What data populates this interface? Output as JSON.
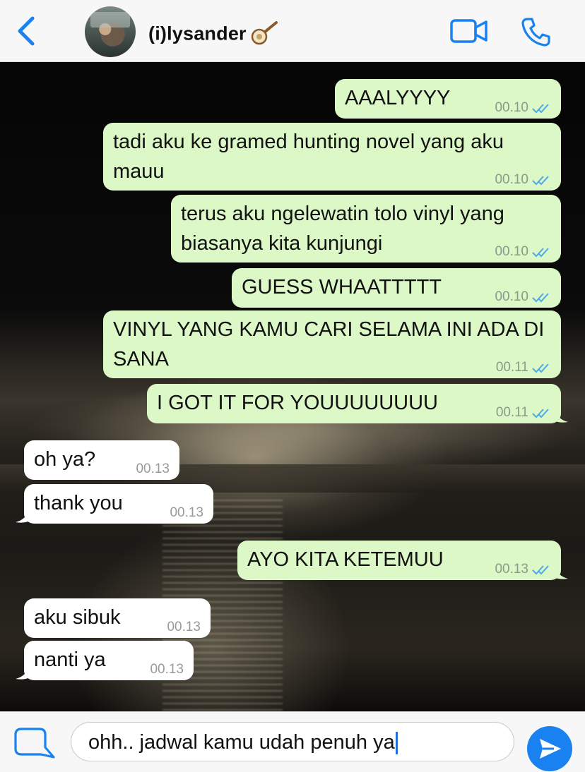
{
  "header": {
    "contact_name": "(i)lysander",
    "emoji": "🪕",
    "accent_color": "#1a82f0"
  },
  "messages": [
    {
      "direction": "out",
      "text": "AAALYYYY",
      "time": "00.10",
      "status": "read"
    },
    {
      "direction": "out",
      "text": "tadi aku ke gramed hunting novel yang aku mauu",
      "time": "00.10",
      "status": "read"
    },
    {
      "direction": "out",
      "text": "terus aku ngelewatin tolo vinyl yang biasanya kita kunjungi",
      "time": "00.10",
      "status": "read"
    },
    {
      "direction": "out",
      "text": "GUESS WHAATTTTT",
      "time": "00.10",
      "status": "read"
    },
    {
      "direction": "out",
      "text": "VINYL YANG KAMU CARI SELAMA INI ADA DI SANA",
      "time": "00.11",
      "status": "read"
    },
    {
      "direction": "out",
      "text": "I GOT IT FOR YOUUUUUUUU",
      "time": "00.11",
      "status": "read"
    },
    {
      "direction": "in",
      "text": "oh ya?",
      "time": "00.13"
    },
    {
      "direction": "in",
      "text": "thank you",
      "time": "00.13"
    },
    {
      "direction": "out",
      "text": "AYO KITA KETEMUU",
      "time": "00.13",
      "status": "read"
    },
    {
      "direction": "in",
      "text": "aku sibuk",
      "time": "00.13"
    },
    {
      "direction": "in",
      "text": "nanti ya",
      "time": "00.13"
    }
  ],
  "composer": {
    "value": "ohh.. jadwal kamu udah penuh ya"
  },
  "colors": {
    "outgoing_bubble": "#dcf8c6",
    "incoming_bubble": "#ffffff",
    "read_tick": "#4fa8e8"
  }
}
